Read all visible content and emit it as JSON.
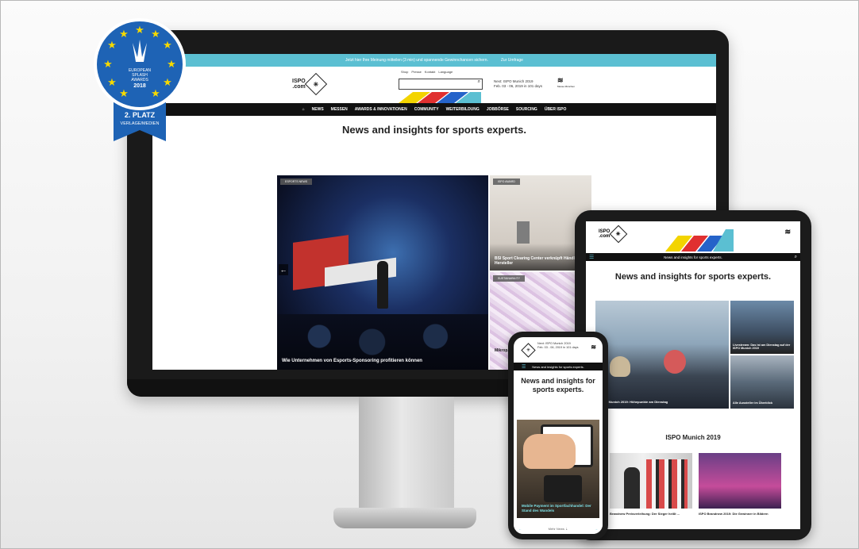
{
  "badge": {
    "line1": "EUROPEAN",
    "line2": "SPLASH",
    "line3": "AWARDS",
    "year": "2018",
    "place": "2. PLATZ",
    "category": "VERLAGE/MEDIEN",
    "colors": {
      "blue": "#1e63b5",
      "star": "#f6d900"
    }
  },
  "desktop": {
    "topbar": {
      "text": "Jetzt hier Ihre Meinung mitteilen (3 min) und spannende Gewinnchancen sichern.",
      "link": "Zur Umfrage"
    },
    "logo": {
      "text1": "ISPO",
      "text2": ".com"
    },
    "mini_nav": [
      "Shop",
      "Presse",
      "Kontakt",
      "Language"
    ],
    "next_event": {
      "line1": "Next: ISPO Munich 2019",
      "line2": "Feb. 03 - 06, 2019 in 101 days"
    },
    "mm_logo": {
      "brand": "Messe München"
    },
    "nav": [
      "NEWS",
      "MESSEN",
      "AWARDS & INNOVATIONEN",
      "COMMUNITY",
      "WEITERBILDUNG",
      "JOBBÖRSE",
      "SOURCING",
      "ÜBER ISPO"
    ],
    "headline": "News and insights for sports experts.",
    "hero_main": {
      "tag": "ESPORTS NEWS",
      "caption": "Wie Unternehmen von Esports-Sponsoring profitieren können"
    },
    "hero_side1": {
      "tag": "ISPO AWARD",
      "caption": "BSI Sport Clearing Center verknüpft Händler und Hersteller"
    },
    "hero_side2": {
      "tag": "SUSTAINABILITY",
      "caption": "Mikrop... saube..."
    }
  },
  "tablet": {
    "logo": {
      "text1": "ISPO",
      "text2": ".com"
    },
    "bar_text": "News and insights for sports experts.",
    "headline": "News and insights for sports experts.",
    "hero_main_caption": "ISPO Munich 2019: Höhepunkte am Dienstag",
    "hero_side1_caption": "Livestream: Das ist am Dienstag auf der ISPO Munich 2019",
    "hero_side2_caption": "Alle Aussteller im Überblick",
    "section_title": "ISPO Munich 2019",
    "card1_caption": "Brandnew Preisverleihung: Der Sieger heißt ...",
    "card2_caption": "ISPO Brandnew 2019: Die Gewinner in Bildern"
  },
  "phone": {
    "next_event": {
      "line1": "Next: ISPO Munich 2019",
      "line2": "Feb. 03 - 06, 2019 in 101 days"
    },
    "bar_text": "News and insights for sports experts.",
    "headline": "News and insights for sports experts.",
    "caption": "Mobile Payment im Sportfachhandel: Der Stand des Wandels",
    "footer": "Mehr News ⇣"
  }
}
